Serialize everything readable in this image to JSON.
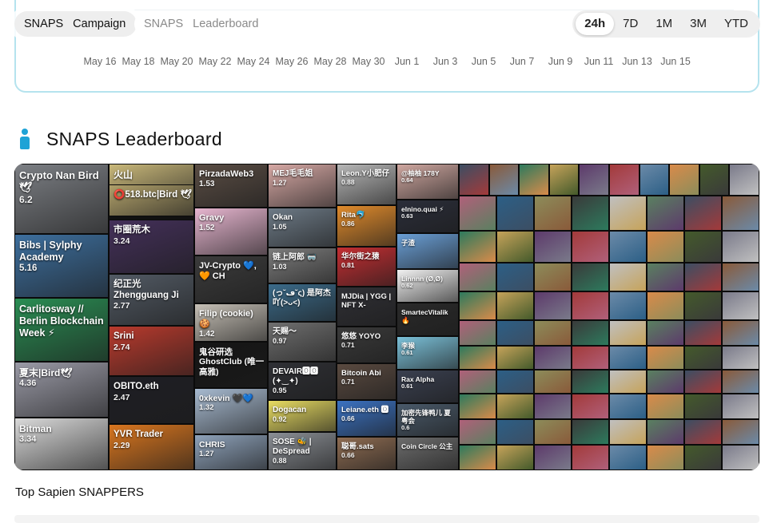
{
  "tabs": {
    "primary": [
      "SNAPS",
      "Campaign"
    ],
    "secondary": [
      "SNAPS",
      "Leaderboard"
    ]
  },
  "ranges": {
    "items": [
      "24h",
      "7D",
      "1M",
      "3M",
      "YTD"
    ],
    "active": "24h"
  },
  "chart": {
    "x_ticks": [
      "May 16",
      "May 18",
      "May 20",
      "May 22",
      "May 24",
      "May 26",
      "May 28",
      "May 30",
      "Jun 1",
      "Jun 3",
      "Jun 5",
      "Jun 7",
      "Jun 9",
      "Jun 11",
      "Jun 13",
      "Jun 15"
    ]
  },
  "leaderboard": {
    "title": "SNAPS Leaderboard",
    "icon": "person-icon",
    "tiles": [
      {
        "name": "Crypto Nan Bird 🕊",
        "score": "6.2",
        "color": "#7c7f84"
      },
      {
        "name": "Bibs | Sylphy Academy",
        "score": "5.16",
        "color": "#3d6f9e"
      },
      {
        "name": "Carlitosway // Berlin Blockchain Week ⚡",
        "score": "",
        "color": "#2a8d53"
      },
      {
        "name": "夏末|Bird🕊",
        "score": "4.36",
        "color": "#9a9aa6"
      },
      {
        "name": "Bitman",
        "score": "3.34",
        "color": "#d9d9d9"
      },
      {
        "name": "火山",
        "score": "",
        "color": "#c9b87a"
      },
      {
        "name": "⭕518.btc|Bird 🕊",
        "score": "",
        "color": "#b0a06a"
      },
      {
        "name": "市圈荒木",
        "score": "3.24",
        "color": "#44305a"
      },
      {
        "name": "纪正光 Zhengguang Ji",
        "score": "2.77",
        "color": "#525a64"
      },
      {
        "name": "Srini",
        "score": "2.74",
        "color": "#b93a2d"
      },
      {
        "name": "OBITO.eth",
        "score": "2.47",
        "color": "#1f1f25"
      },
      {
        "name": "YVR Trader",
        "score": "2.29",
        "color": "#d9761f"
      },
      {
        "name": "PirzadaWeb3",
        "score": "1.53",
        "color": "#5a4d44"
      },
      {
        "name": "Gravy",
        "score": "1.52",
        "color": "#e6b5cf"
      },
      {
        "name": "JV-Crypto 💙,🧡 CH",
        "score": "",
        "color": "#3b3b3b"
      },
      {
        "name": "Filip (cookie) 🍪",
        "score": "1.42",
        "color": "#c6c0b6"
      },
      {
        "name": "鬼谷研选 GhostClub (唯一高雅)",
        "score": "",
        "color": "#151515"
      },
      {
        "name": "0xkevin 🖤💙",
        "score": "1.32",
        "color": "#a7bad0"
      },
      {
        "name": "CHRIS",
        "score": "1.27",
        "color": "#8ea2ba"
      },
      {
        "name": "MEJ毛毛姐",
        "score": "1.27",
        "color": "#d6a8a4"
      },
      {
        "name": "Okan",
        "score": "1.05",
        "color": "#6d7a86"
      },
      {
        "name": "链上阿郎 🥽",
        "score": "1.03",
        "color": "#7c7c7c"
      },
      {
        "name": "(っ˘ڡ˘ς) 是阿杰 吖(>ᴗ<)",
        "score": "",
        "color": "#3b6b8a"
      },
      {
        "name": "天赐〜",
        "score": "0.97",
        "color": "#6f6f6f"
      },
      {
        "name": "DEVAIR🅾🅾 (✦‿✦)",
        "score": "0.95",
        "color": "#2f3035"
      },
      {
        "name": "Dogacan",
        "score": "0.92",
        "color": "#e8dc62"
      },
      {
        "name": "SOSE 🐝 | DeSpread",
        "score": "0.88",
        "color": "#8b8f95"
      },
      {
        "name": "Leon.Y小肥仔",
        "score": "0.88",
        "color": "#b7b7b7"
      },
      {
        "name": "Rita🐬",
        "score": "0.86",
        "color": "#e08b2c"
      },
      {
        "name": "华尔街之猿",
        "score": "0.81",
        "color": "#c42e32"
      },
      {
        "name": "MJDia | YGG | NFT X-",
        "score": "",
        "color": "#303035"
      },
      {
        "name": "悠悠 YOYO",
        "score": "0.71",
        "color": "#3a3a3a"
      },
      {
        "name": "Bitcoin Abi",
        "score": "0.71",
        "color": "#5a4a40"
      },
      {
        "name": "Leiane.eth 🅾",
        "score": "0.66",
        "color": "#3b72c2"
      },
      {
        "name": "聪哥.sats",
        "score": "0.66",
        "color": "#8e6c52"
      },
      {
        "name": "@柚柚 178Y",
        "score": "0.64",
        "color": "#cfa7a0"
      },
      {
        "name": "elnino.quai ⚡",
        "score": "0.63",
        "color": "#2b2e3a"
      },
      {
        "name": "子渣",
        "score": "",
        "color": "#6a9fd6"
      },
      {
        "name": "Linnnn (Ø,Ø)",
        "score": "0.62",
        "color": "#f2f2f2"
      },
      {
        "name": "SmartecVitalik 🔥",
        "score": "",
        "color": "#2a2a2a"
      },
      {
        "name": "李猴",
        "score": "0.61",
        "color": "#7bc1d9"
      },
      {
        "name": "Rax Alpha",
        "score": "0.61",
        "color": "#3a4050"
      },
      {
        "name": "加密先锋鸭儿 夏粤会",
        "score": "0.6",
        "color": "#4a5a6a"
      },
      {
        "name": "Coin Circle 公主",
        "score": "",
        "color": "#6c6c6c"
      }
    ]
  },
  "footer": {
    "label": "Top Sapien SNAPPERS"
  }
}
